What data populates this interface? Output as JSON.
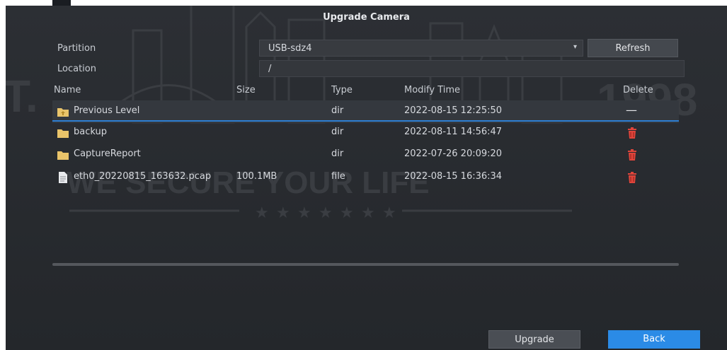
{
  "dialog": {
    "title": "Upgrade Camera"
  },
  "partition": {
    "label": "Partition",
    "value": "USB-sdz4",
    "refresh_label": "Refresh"
  },
  "location": {
    "label": "Location",
    "value": "/"
  },
  "table": {
    "headers": {
      "name": "Name",
      "size": "Size",
      "type": "Type",
      "modify_time": "Modify Time",
      "delete": "Delete"
    },
    "rows": [
      {
        "name": "Previous Level",
        "size": "",
        "type": "dir",
        "modify_time": "2022-08-15 12:25:50",
        "icon": "folder-up-icon",
        "delete": "dash"
      },
      {
        "name": "backup",
        "size": "",
        "type": "dir",
        "modify_time": "2022-08-11 14:56:47",
        "icon": "folder-icon",
        "delete": "trash"
      },
      {
        "name": "CaptureReport",
        "size": "",
        "type": "dir",
        "modify_time": "2022-07-26 20:09:20",
        "icon": "folder-icon",
        "delete": "trash"
      },
      {
        "name": "eth0_20220815_163632.pcap",
        "size": "100.1MB",
        "type": "file",
        "modify_time": "2022-08-15 16:36:34",
        "icon": "file-icon",
        "delete": "trash"
      }
    ]
  },
  "buttons": {
    "upgrade": "Upgrade",
    "back": "Back"
  },
  "watermark": {
    "left_text": "T.",
    "right_text": "1998",
    "slogan": "WE SECURE YOUR LIFE"
  },
  "colors": {
    "accent": "#2b8be6",
    "delete": "#e0453b",
    "folder": "#e9c46a"
  }
}
